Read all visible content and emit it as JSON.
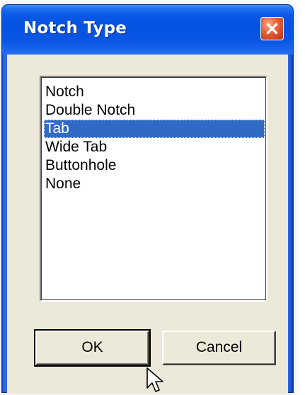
{
  "window": {
    "title": "Notch Type",
    "close_icon": "close-icon"
  },
  "listbox": {
    "items": [
      "Notch",
      "Double Notch",
      "Tab",
      "Wide Tab",
      "Buttonhole",
      "None"
    ],
    "selected": "Tab"
  },
  "buttons": {
    "ok_label": "OK",
    "cancel_label": "Cancel"
  },
  "colors": {
    "title_bar": "#0552e0",
    "selection": "#316ac5",
    "face": "#ece9d8",
    "close_button": "#d2441f"
  },
  "icons": {
    "close": "close-icon",
    "cursor": "mouse-pointer-icon"
  }
}
